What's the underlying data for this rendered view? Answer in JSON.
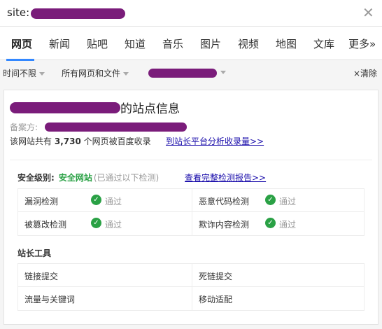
{
  "search": {
    "value": "site:"
  },
  "tabs": [
    {
      "label": "网页",
      "active": true
    },
    {
      "label": "新闻"
    },
    {
      "label": "贴吧"
    },
    {
      "label": "知道"
    },
    {
      "label": "音乐"
    },
    {
      "label": "图片"
    },
    {
      "label": "视频"
    },
    {
      "label": "地图"
    },
    {
      "label": "文库"
    },
    {
      "label": "更多»"
    }
  ],
  "filters": {
    "time": "时间不限",
    "type": "所有网页和文件",
    "clear": "×清除"
  },
  "card": {
    "title_suffix": "的站点信息",
    "beian_label": "备案方:",
    "indexed_prefix": "该网站共有",
    "indexed_count": "3,730",
    "indexed_suffix": "个网页被百度收录",
    "indexed_link": "到站长平台分析收录量>>",
    "security": {
      "label": "安全级别:",
      "value": "安全网站",
      "note": "(已通过以下检测)",
      "link": "查看完整检测报告>>",
      "checks": [
        {
          "label": "漏洞检测",
          "status": "通过"
        },
        {
          "label": "恶意代码检测",
          "status": "通过"
        },
        {
          "label": "被篡改检测",
          "status": "通过"
        },
        {
          "label": "欺诈内容检测",
          "status": "通过"
        }
      ]
    },
    "tools": {
      "title": "站长工具",
      "items": [
        "链接提交",
        "死链提交",
        "流量与关键词",
        "移动适配"
      ]
    }
  },
  "colors": {
    "accent": "#3388ff",
    "safe": "#2aa145",
    "link": "#1a0dab"
  }
}
